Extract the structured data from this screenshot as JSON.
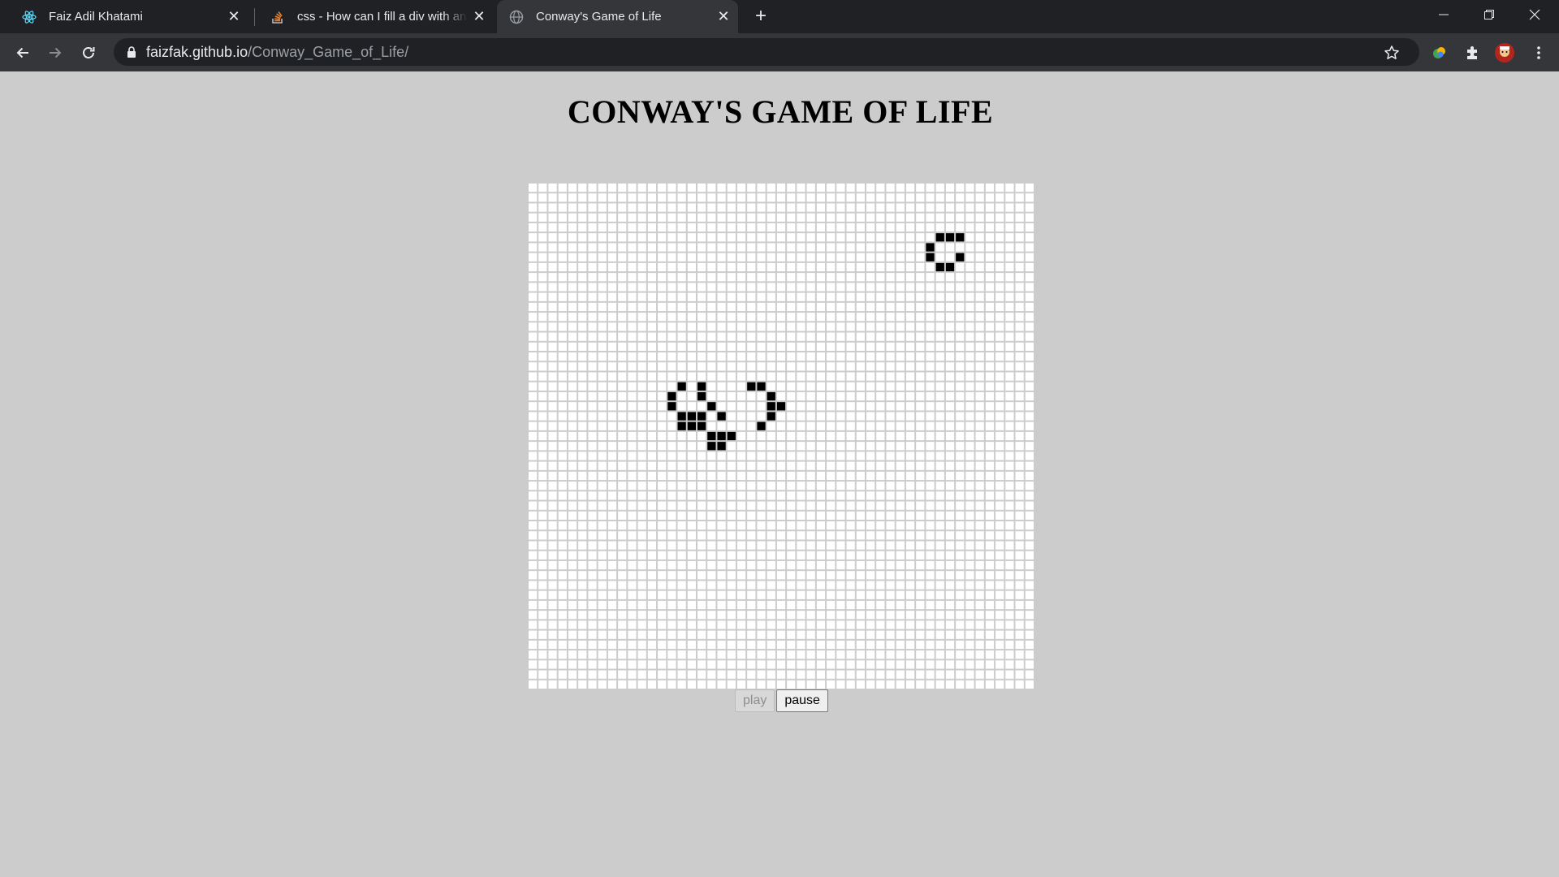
{
  "browser": {
    "tabs": [
      {
        "title": "Faiz Adil Khatami",
        "favicon": "react-icon",
        "active": false
      },
      {
        "title": "css - How can I fill a div with an image",
        "favicon": "stackoverflow-icon",
        "active": false
      },
      {
        "title": "Conway's Game of Life",
        "favicon": "globe-icon",
        "active": true
      }
    ],
    "url_host": "faizfak.github.io",
    "url_path": "/Conway_Game_of_Life/"
  },
  "page": {
    "heading": "CONWAY'S GAME OF LIFE",
    "play_label": "play",
    "pause_label": "pause",
    "play_disabled": true
  },
  "board": {
    "columns": 51,
    "rows": 51,
    "cell_color": "#ffffff",
    "alive_color": "#000000",
    "grid_color": "#cccccc",
    "alive_cells": [
      [
        41,
        5
      ],
      [
        42,
        5
      ],
      [
        43,
        5
      ],
      [
        40,
        6
      ],
      [
        40,
        7
      ],
      [
        43,
        7
      ],
      [
        41,
        8
      ],
      [
        42,
        8
      ],
      [
        15,
        20
      ],
      [
        17,
        20
      ],
      [
        22,
        20
      ],
      [
        23,
        20
      ],
      [
        14,
        21
      ],
      [
        17,
        21
      ],
      [
        24,
        21
      ],
      [
        14,
        22
      ],
      [
        18,
        22
      ],
      [
        24,
        22
      ],
      [
        25,
        22
      ],
      [
        15,
        23
      ],
      [
        16,
        23
      ],
      [
        17,
        23
      ],
      [
        19,
        23
      ],
      [
        24,
        23
      ],
      [
        15,
        24
      ],
      [
        16,
        24
      ],
      [
        17,
        24
      ],
      [
        23,
        24
      ],
      [
        18,
        25
      ],
      [
        19,
        25
      ],
      [
        20,
        25
      ],
      [
        18,
        26
      ],
      [
        19,
        26
      ]
    ]
  }
}
